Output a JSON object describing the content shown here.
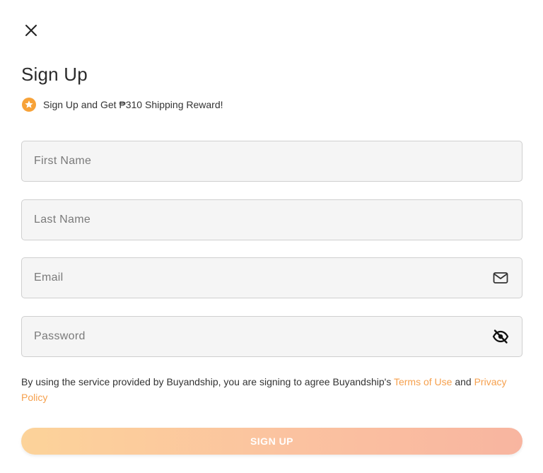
{
  "header": {
    "title": "Sign Up"
  },
  "reward": {
    "text": "Sign Up and Get ₱310 Shipping Reward!"
  },
  "form": {
    "first_name": {
      "placeholder": "First Name",
      "value": ""
    },
    "last_name": {
      "placeholder": "Last Name",
      "value": ""
    },
    "email": {
      "placeholder": "Email",
      "value": ""
    },
    "password": {
      "placeholder": "Password",
      "value": ""
    }
  },
  "terms": {
    "prefix": "By using the service provided by Buyandship, you are signing to agree Buyandship's ",
    "terms_link": "Terms of Use",
    "middle": " and ",
    "privacy_link": "Privacy Policy"
  },
  "actions": {
    "signup_label": "SIGN UP"
  },
  "colors": {
    "accent": "#f6a04d",
    "star_badge": "#f7a238",
    "button_gradient_start": "#fcd39a",
    "button_gradient_end": "#f8b5a0"
  }
}
